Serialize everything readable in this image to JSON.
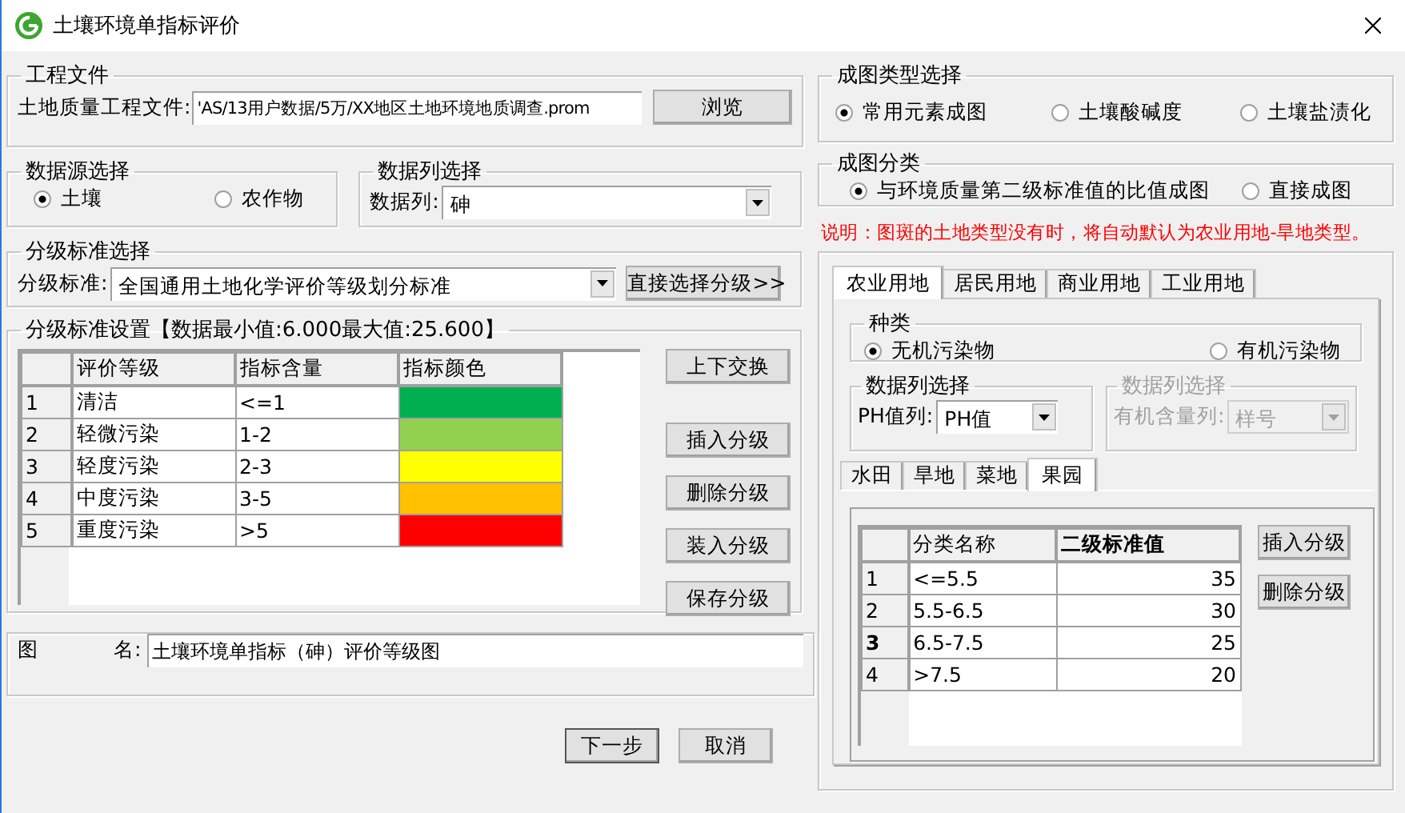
{
  "window": {
    "title": "土壤环境单指标评价"
  },
  "project_file": {
    "title": "工程文件",
    "label": "土地质量工程文件:",
    "value": "'AS/13用户数据/5万/XX地区土地环境地质调查.prom",
    "button": "浏览"
  },
  "data_source": {
    "title": "数据源选择",
    "options": [
      {
        "label": "土壤",
        "selected": true
      },
      {
        "label": "农作物",
        "selected": false
      }
    ]
  },
  "data_column": {
    "title": "数据列选择",
    "label": "数据列:",
    "value": "砷"
  },
  "grading_standard": {
    "title": "分级标准选择",
    "label": "分级标准:",
    "value": "全国通用土地化学评价等级划分标准",
    "button": "直接选择分级>>"
  },
  "grading_settings": {
    "title": "分级标准设置【数据最小值:6.000最大值:25.600】",
    "columns": [
      "评价等级",
      "指标含量",
      "指标颜色"
    ],
    "rows": [
      {
        "index": "1",
        "grade": "清洁",
        "range": "<=1",
        "color": "#00b050"
      },
      {
        "index": "2",
        "grade": "轻微污染",
        "range": "1-2",
        "color": "#92d050"
      },
      {
        "index": "3",
        "grade": "轻度污染",
        "range": "2-3",
        "color": "#ffff00"
      },
      {
        "index": "4",
        "grade": "中度污染",
        "range": "3-5",
        "color": "#ffc000"
      },
      {
        "index": "5",
        "grade": "重度污染",
        "range": ">5",
        "color": "#ff0000"
      }
    ],
    "buttons": [
      "上下交换",
      "插入分级",
      "删除分级",
      "装入分级",
      "保存分级"
    ]
  },
  "map_name": {
    "label_1": "图",
    "label_2": "名:",
    "value": "土壤环境单指标（砷）评价等级图"
  },
  "footer_buttons": [
    "下一步",
    "取消"
  ],
  "map_type": {
    "title": "成图类型选择",
    "options": [
      {
        "label": "常用元素成图",
        "selected": true
      },
      {
        "label": "土壤酸碱度",
        "selected": false
      },
      {
        "label": "土壤盐渍化",
        "selected": false
      }
    ]
  },
  "map_class": {
    "title": "成图分类",
    "options": [
      {
        "label": "与环境质量第二级标准值的比值成图",
        "selected": true
      },
      {
        "label": "直接成图",
        "selected": false
      }
    ]
  },
  "note": "说明：图斑的土地类型没有时，将自动默认为农业用地-旱地类型。",
  "land_tabs": [
    {
      "label": "农业用地",
      "selected": true
    },
    {
      "label": "居民用地",
      "selected": false
    },
    {
      "label": "商业用地",
      "selected": false
    },
    {
      "label": "工业用地",
      "selected": false
    }
  ],
  "category": {
    "title": "种类",
    "options": [
      {
        "label": "无机污染物",
        "selected": true
      },
      {
        "label": "有机污染物",
        "selected": false
      }
    ]
  },
  "ph_column": {
    "title": "数据列选择",
    "label": "PH值列:",
    "value": "PH值",
    "disabled": false
  },
  "organic_column": {
    "title": "数据列选择",
    "label": "有机含量列:",
    "value": "样号",
    "disabled": true
  },
  "crop_tabs": [
    {
      "label": "水田",
      "selected": false
    },
    {
      "label": "旱地",
      "selected": false
    },
    {
      "label": "菜地",
      "selected": false
    },
    {
      "label": "果园",
      "selected": true
    }
  ],
  "standard_table": {
    "columns": [
      "分类名称",
      "二级标准值"
    ],
    "rows": [
      {
        "index": "1",
        "name": "<=5.5",
        "value": "35",
        "selected": false
      },
      {
        "index": "2",
        "name": "5.5-6.5",
        "value": "30",
        "selected": false
      },
      {
        "index": "3",
        "name": "6.5-7.5",
        "value": "25",
        "selected": true
      },
      {
        "index": "4",
        "name": ">7.5",
        "value": "20",
        "selected": false
      }
    ],
    "buttons": [
      "插入分级",
      "删除分级"
    ]
  }
}
